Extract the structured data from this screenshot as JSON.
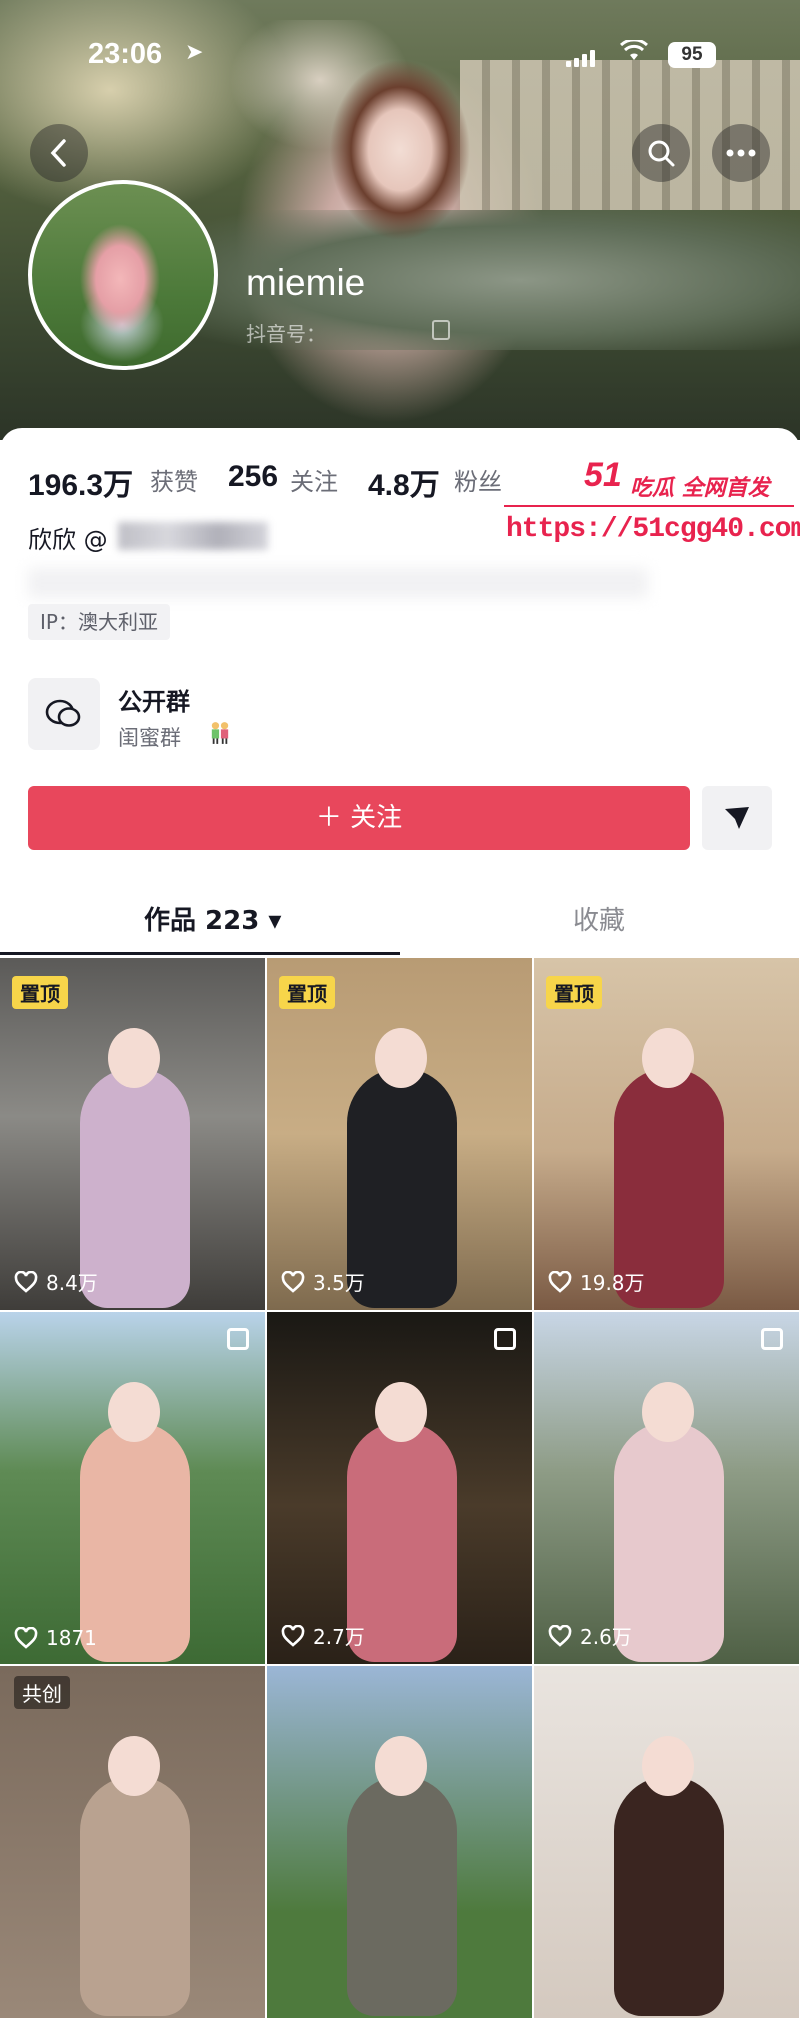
{
  "status_bar": {
    "time": "23:06",
    "battery": "95",
    "location_icon": "location-arrow-icon",
    "wifi_icon": "wifi-icon",
    "signal_icon": "signal-icon"
  },
  "header": {
    "back_icon": "chevron-left-icon",
    "search_icon": "search-icon",
    "more_icon": "more-dots-icon"
  },
  "profile": {
    "username": "miemie",
    "douyin_id_label": "抖音号：",
    "stats": [
      {
        "value": "196.3万",
        "label": "获赞"
      },
      {
        "value": "256",
        "label": "关注"
      },
      {
        "value": "4.8万",
        "label": "粉丝"
      }
    ],
    "bio": "欣欣 @",
    "ip": "IP：澳大利亚"
  },
  "group": {
    "title": "公开群",
    "subtitle": "闺蜜群"
  },
  "actions": {
    "follow_label": "＋ 关注",
    "share_icon": "send-arrow-icon"
  },
  "tabs": {
    "works": "作品 223 ▾",
    "favorites": "收藏"
  },
  "watermark": {
    "logo": "51",
    "tagline": "吃瓜 全网首发",
    "url": "https://51cgg40.com"
  },
  "accent": "#e8475c",
  "videos": [
    {
      "likes": "8.4万",
      "badge": "置顶",
      "multi": false
    },
    {
      "likes": "3.5万",
      "badge": "置顶",
      "multi": false
    },
    {
      "likes": "19.8万",
      "badge": "置顶",
      "multi": false
    },
    {
      "likes": "1871",
      "badge": "",
      "multi": true
    },
    {
      "likes": "2.7万",
      "badge": "",
      "multi": true
    },
    {
      "likes": "2.6万",
      "badge": "",
      "multi": true
    },
    {
      "likes": "",
      "badge": "共创",
      "multi": false
    },
    {
      "likes": "",
      "badge": "",
      "multi": false
    },
    {
      "likes": "",
      "badge": "",
      "multi": false
    }
  ]
}
